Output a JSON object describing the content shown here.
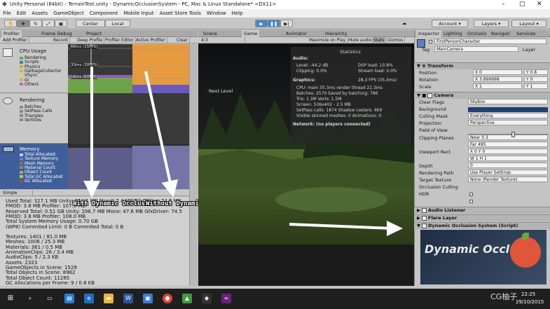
{
  "window": {
    "title": "Unity Personal (64bit) - TerrainTest.unity - DynamicOcclusionSystem - PC, Mac & Linux Standalone* <DX11>"
  },
  "menu": [
    "File",
    "Edit",
    "Assets",
    "GameObject",
    "Component",
    "Mobile Input",
    "Asset Store Tools",
    "Window",
    "Help"
  ],
  "toolbar": {
    "center": "Center",
    "local": "Local",
    "account": "Account",
    "layers": "Layers",
    "layout": "Layout"
  },
  "profiler": {
    "tabs": [
      "Profiler",
      "Frame Debug",
      "Project"
    ],
    "buttons": [
      "Add Profiler",
      "Record",
      "Deep Profile",
      "Profiler Editor",
      "Active Profiler",
      "Clear"
    ],
    "cpu_title": "CPU Usage",
    "cpu_items": [
      "Rendering",
      "Scripts",
      "Physics",
      "GarbageCollector",
      "VSync",
      "Gi",
      "Others"
    ],
    "cpu_colors": [
      "#6fa34a",
      "#4a78c7",
      "#e0a23c",
      "#b0c545",
      "#e8d35a",
      "#bdaf7a",
      "#b66ac0"
    ],
    "fps_labels": [
      "66ms (15FPS)",
      "33ms (30FPS)",
      "16ms (60FPS)"
    ],
    "render_title": "Rendering",
    "render_items": [
      "Batches",
      "SetPass Calls",
      "Triangles",
      "Vertices"
    ],
    "memory_title": "Memory",
    "memory_items": [
      "Total Allocated",
      "Texture Memory",
      "Mesh Memory",
      "Material Count",
      "Object Count",
      "Total GC Allocated",
      "GC Allocated"
    ],
    "memory_colors": [
      "#c7c7ff",
      "#6a7bd6",
      "#b65e5e",
      "#5e9d8a",
      "#c8a04a",
      "#9bd66a",
      "#c24040"
    ],
    "mode": "Simple",
    "lines": [
      "Used Total: 327.1 MB   Unity: 144.1 MB   Mono: 7.4 MB   GfxDriver: 74.5 MB",
      "FMOD: 3.8 MB   Profiler: 107.9 MB",
      "Reserved Total: 0.51 GB   Unity: 296.7 MB   Mono: 47.6 MB   GfxDriver: 74.5",
      "FMOD: 3.8 MB   Profiler: 108.0 MB",
      "Total System Memory Usage: 0.70 GB",
      "(WP8) Commited Limit: 0 B    Commited Total: 0 B",
      "",
      "Textures: 1401 / 81.0 MB",
      "Meshes: 1006 / 25.3 MB",
      "Materials: 361 / 0.5 MB",
      "AnimationClips: 26 / 3.4 MB",
      "AudioClips: 5 / 2.3 KB",
      "Assets: 2323",
      "GameObjects in Scene: 1529",
      "Total Objects in Scene: 8962",
      "Total Object Count: 11285",
      "GC Allocations per Frame: 9 / 0.8 KB"
    ]
  },
  "annotations": {
    "with": "With Dynamic Occlusion",
    "without": "Without Dynamic Occlusion"
  },
  "game": {
    "tabs": [
      "Scene",
      "Game",
      "Animator",
      "Hierarchy"
    ],
    "aspect": "4:3",
    "buttons": [
      "Maximize on Play",
      "Mute audio",
      "Stats",
      "Gizmos"
    ],
    "next_level": "Next Level",
    "stats_title": "Statistics",
    "audio_label": "Audio:",
    "audio": [
      "Level: -44.2 dB",
      "Clipping: 0.0%",
      "DSP load: 10.8%",
      "Stream load: 0.0%"
    ],
    "graphics_label": "Graphics:",
    "fps": "28.3 FPS (35.3ms)",
    "graphics": [
      "CPU: main 35.3ms  render thread 22.3ms",
      "Batches: 2570   Saved by batching: 786",
      "Tris: 1.3M    Verts: 1.5M",
      "Screen: 536x402 - 2.5 MB",
      "SetPass calls: 1874   Shadow casters: 469",
      "Visible skinned meshes: 0   Animations: 0"
    ],
    "network": "Network: (no players connected)"
  },
  "inspector": {
    "tabs": [
      "Inspector",
      "Lighting",
      "Occlusio",
      "Navigati",
      "Services"
    ],
    "object_name": "FirstPersonCharacter",
    "tag_label": "Tag",
    "tag": "MainCamera",
    "layer_label": "Layer",
    "transform_title": "Transform",
    "position": [
      "Position",
      "X 0",
      "Y 0.8"
    ],
    "rotation": [
      "Rotation",
      "X 3.899998",
      "Y 0"
    ],
    "scale": [
      "Scale",
      "X 1",
      "Y 1"
    ],
    "camera_title": "Camera",
    "camera_rows": [
      [
        "Clear Flags",
        "Skybox"
      ],
      [
        "Background",
        ""
      ],
      [
        "Culling Mask",
        "Everything"
      ],
      [
        "Projection",
        "Perspective"
      ],
      [
        "Field of View",
        ""
      ],
      [
        "Clipping Planes",
        "Near  0.3"
      ],
      [
        "",
        "Far   495"
      ],
      [
        "Viewport Rect",
        "X 0        Y 0"
      ],
      [
        "",
        "W 1        H 1"
      ],
      [
        "Depth",
        "0"
      ],
      [
        "Rendering Path",
        "Use Player Settings"
      ],
      [
        "Target Texture",
        "None (Render Texture)"
      ],
      [
        "Occlusion Culling",
        ""
      ],
      [
        "HDR",
        ""
      ]
    ],
    "components": [
      "Audio Listener",
      "Flare Layer",
      "Dynamic Occlusion System (Script)"
    ],
    "banner_text": "Dynamic Occlus"
  },
  "taskbar": {
    "time": "22:25",
    "date": "29/10/2015",
    "watermark": "CG柚子"
  }
}
